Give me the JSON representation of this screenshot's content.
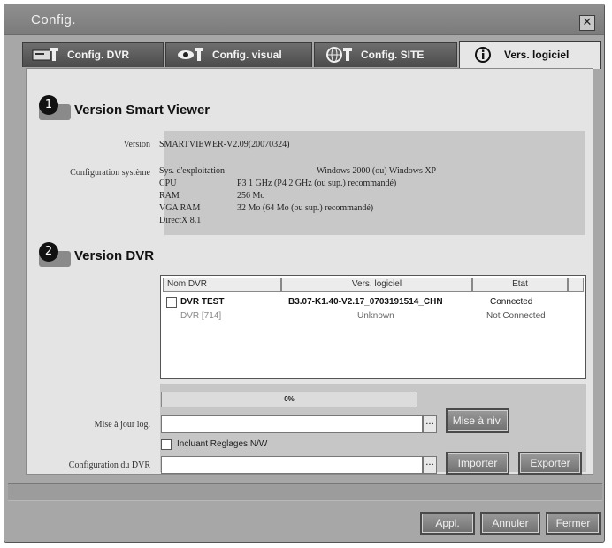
{
  "window": {
    "title": "Config."
  },
  "tabs": [
    {
      "label": "Config. DVR",
      "icon": "dvr-wrench-icon"
    },
    {
      "label": "Config. visual",
      "icon": "eye-wrench-icon"
    },
    {
      "label": "Config. SITE",
      "icon": "globe-wrench-icon"
    },
    {
      "label": "Vers. logiciel",
      "icon": "info-icon"
    }
  ],
  "section1": {
    "number": "1",
    "title": "Version Smart Viewer",
    "version_label": "Version",
    "version_value": "SMARTVIEWER-V2.09(20070324)",
    "sysconfig_label": "Configuration système",
    "sys": [
      {
        "name": "Sys. d'exploitation",
        "value": "Windows 2000 (ou) Windows XP"
      },
      {
        "name": "CPU",
        "value": "P3 1 GHz (P4 2 GHz (ou sup.) recommandé)"
      },
      {
        "name": "RAM",
        "value": "256 Mo"
      },
      {
        "name": "VGA RAM",
        "value": "32 Mo (64 Mo (ou sup.) recommandé)"
      },
      {
        "name": "DirectX 8.1",
        "value": ""
      }
    ]
  },
  "section2": {
    "number": "2",
    "title": "Version DVR",
    "columns": [
      "Nom DVR",
      "Vers. logiciel",
      "Etat"
    ],
    "rows": [
      {
        "name": "DVR TEST",
        "version": "B3.07-K1.40-V2.17_0703191514_CHN",
        "state": "Connected",
        "checkbox": true
      },
      {
        "name": "DVR [714]",
        "version": "Unknown",
        "state": "Not Connected",
        "checkbox": false
      }
    ],
    "progress_text": "0%",
    "progress_value": 0,
    "update_log_label": "Mise à jour log.",
    "update_log_value": "",
    "browse_label": "...",
    "update_button": "Mise à niv.",
    "include_network_label": "Incluant Reglages N/W",
    "dvr_config_label": "Configuration du DVR",
    "dvr_config_value": "",
    "import_button": "Importer",
    "export_button": "Exporter"
  },
  "footer": {
    "apply": "Appl.",
    "cancel": "Annuler",
    "close": "Fermer"
  }
}
